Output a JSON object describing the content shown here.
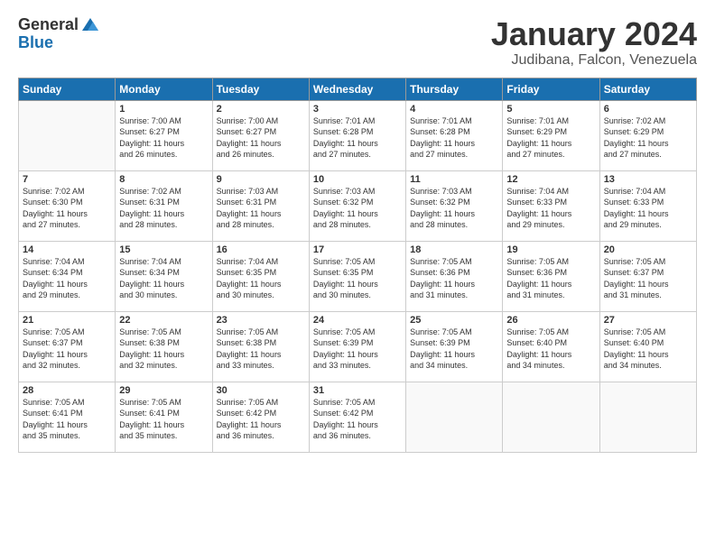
{
  "logo": {
    "general": "General",
    "blue": "Blue"
  },
  "title": "January 2024",
  "subtitle": "Judibana, Falcon, Venezuela",
  "headers": [
    "Sunday",
    "Monday",
    "Tuesday",
    "Wednesday",
    "Thursday",
    "Friday",
    "Saturday"
  ],
  "weeks": [
    [
      {
        "day": "",
        "info": ""
      },
      {
        "day": "1",
        "info": "Sunrise: 7:00 AM\nSunset: 6:27 PM\nDaylight: 11 hours\nand 26 minutes."
      },
      {
        "day": "2",
        "info": "Sunrise: 7:00 AM\nSunset: 6:27 PM\nDaylight: 11 hours\nand 26 minutes."
      },
      {
        "day": "3",
        "info": "Sunrise: 7:01 AM\nSunset: 6:28 PM\nDaylight: 11 hours\nand 27 minutes."
      },
      {
        "day": "4",
        "info": "Sunrise: 7:01 AM\nSunset: 6:28 PM\nDaylight: 11 hours\nand 27 minutes."
      },
      {
        "day": "5",
        "info": "Sunrise: 7:01 AM\nSunset: 6:29 PM\nDaylight: 11 hours\nand 27 minutes."
      },
      {
        "day": "6",
        "info": "Sunrise: 7:02 AM\nSunset: 6:29 PM\nDaylight: 11 hours\nand 27 minutes."
      }
    ],
    [
      {
        "day": "7",
        "info": "Sunrise: 7:02 AM\nSunset: 6:30 PM\nDaylight: 11 hours\nand 27 minutes."
      },
      {
        "day": "8",
        "info": "Sunrise: 7:02 AM\nSunset: 6:31 PM\nDaylight: 11 hours\nand 28 minutes."
      },
      {
        "day": "9",
        "info": "Sunrise: 7:03 AM\nSunset: 6:31 PM\nDaylight: 11 hours\nand 28 minutes."
      },
      {
        "day": "10",
        "info": "Sunrise: 7:03 AM\nSunset: 6:32 PM\nDaylight: 11 hours\nand 28 minutes."
      },
      {
        "day": "11",
        "info": "Sunrise: 7:03 AM\nSunset: 6:32 PM\nDaylight: 11 hours\nand 28 minutes."
      },
      {
        "day": "12",
        "info": "Sunrise: 7:04 AM\nSunset: 6:33 PM\nDaylight: 11 hours\nand 29 minutes."
      },
      {
        "day": "13",
        "info": "Sunrise: 7:04 AM\nSunset: 6:33 PM\nDaylight: 11 hours\nand 29 minutes."
      }
    ],
    [
      {
        "day": "14",
        "info": "Sunrise: 7:04 AM\nSunset: 6:34 PM\nDaylight: 11 hours\nand 29 minutes."
      },
      {
        "day": "15",
        "info": "Sunrise: 7:04 AM\nSunset: 6:34 PM\nDaylight: 11 hours\nand 30 minutes."
      },
      {
        "day": "16",
        "info": "Sunrise: 7:04 AM\nSunset: 6:35 PM\nDaylight: 11 hours\nand 30 minutes."
      },
      {
        "day": "17",
        "info": "Sunrise: 7:05 AM\nSunset: 6:35 PM\nDaylight: 11 hours\nand 30 minutes."
      },
      {
        "day": "18",
        "info": "Sunrise: 7:05 AM\nSunset: 6:36 PM\nDaylight: 11 hours\nand 31 minutes."
      },
      {
        "day": "19",
        "info": "Sunrise: 7:05 AM\nSunset: 6:36 PM\nDaylight: 11 hours\nand 31 minutes."
      },
      {
        "day": "20",
        "info": "Sunrise: 7:05 AM\nSunset: 6:37 PM\nDaylight: 11 hours\nand 31 minutes."
      }
    ],
    [
      {
        "day": "21",
        "info": "Sunrise: 7:05 AM\nSunset: 6:37 PM\nDaylight: 11 hours\nand 32 minutes."
      },
      {
        "day": "22",
        "info": "Sunrise: 7:05 AM\nSunset: 6:38 PM\nDaylight: 11 hours\nand 32 minutes."
      },
      {
        "day": "23",
        "info": "Sunrise: 7:05 AM\nSunset: 6:38 PM\nDaylight: 11 hours\nand 33 minutes."
      },
      {
        "day": "24",
        "info": "Sunrise: 7:05 AM\nSunset: 6:39 PM\nDaylight: 11 hours\nand 33 minutes."
      },
      {
        "day": "25",
        "info": "Sunrise: 7:05 AM\nSunset: 6:39 PM\nDaylight: 11 hours\nand 34 minutes."
      },
      {
        "day": "26",
        "info": "Sunrise: 7:05 AM\nSunset: 6:40 PM\nDaylight: 11 hours\nand 34 minutes."
      },
      {
        "day": "27",
        "info": "Sunrise: 7:05 AM\nSunset: 6:40 PM\nDaylight: 11 hours\nand 34 minutes."
      }
    ],
    [
      {
        "day": "28",
        "info": "Sunrise: 7:05 AM\nSunset: 6:41 PM\nDaylight: 11 hours\nand 35 minutes."
      },
      {
        "day": "29",
        "info": "Sunrise: 7:05 AM\nSunset: 6:41 PM\nDaylight: 11 hours\nand 35 minutes."
      },
      {
        "day": "30",
        "info": "Sunrise: 7:05 AM\nSunset: 6:42 PM\nDaylight: 11 hours\nand 36 minutes."
      },
      {
        "day": "31",
        "info": "Sunrise: 7:05 AM\nSunset: 6:42 PM\nDaylight: 11 hours\nand 36 minutes."
      },
      {
        "day": "",
        "info": ""
      },
      {
        "day": "",
        "info": ""
      },
      {
        "day": "",
        "info": ""
      }
    ]
  ]
}
